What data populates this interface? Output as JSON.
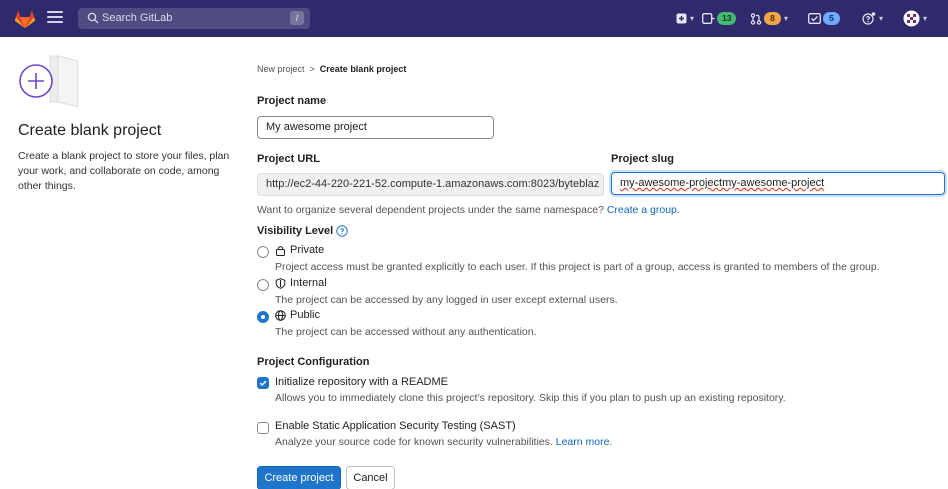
{
  "navbar": {
    "search_placeholder": "Search GitLab",
    "search_shortcut": "/",
    "mr_count": "13",
    "review_count": "8",
    "todo_count": "5"
  },
  "left": {
    "title": "Create blank project",
    "description": "Create a blank project to store your files, plan your work, and collaborate on code, among other things."
  },
  "breadcrumb": {
    "parent": "New project",
    "separator": ">",
    "current": "Create blank project"
  },
  "form": {
    "project_name_label": "Project name",
    "project_name_value": "My awesome project",
    "project_url_label": "Project URL",
    "project_url_value": "http://ec2-44-220-221-52.compute-1.amazonaws.com:8023/byteblaz",
    "project_slug_label": "Project slug",
    "project_slug_value": "my-awesome-projectmy-awesome-project",
    "namespace_help": "Want to organize several dependent projects under the same namespace?",
    "create_group_link": "Create a group.",
    "visibility_label": "Visibility Level",
    "visibility": [
      {
        "label": "Private",
        "description": "Project access must be granted explicitly to each user. If this project is part of a group, access is granted to members of the group.",
        "checked": false,
        "icon": "lock-icon"
      },
      {
        "label": "Internal",
        "description": "The project can be accessed by any logged in user except external users.",
        "checked": false,
        "icon": "shield-icon"
      },
      {
        "label": "Public",
        "description": "The project can be accessed without any authentication.",
        "checked": true,
        "icon": "globe-icon"
      }
    ],
    "config_label": "Project Configuration",
    "readme_label": "Initialize repository with a README",
    "readme_desc": "Allows you to immediately clone this project’s repository. Skip this if you plan to push up an existing repository.",
    "readme_checked": true,
    "sast_label": "Enable Static Application Security Testing (SAST)",
    "sast_desc": "Analyze your source code for known security vulnerabilities.",
    "learn_more": "Learn more.",
    "sast_checked": false,
    "create_button": "Create project",
    "cancel_button": "Cancel"
  },
  "colors": {
    "navbar_bg": "#2f2a6b",
    "primary": "#1f75cb",
    "link": "#1068bf"
  }
}
